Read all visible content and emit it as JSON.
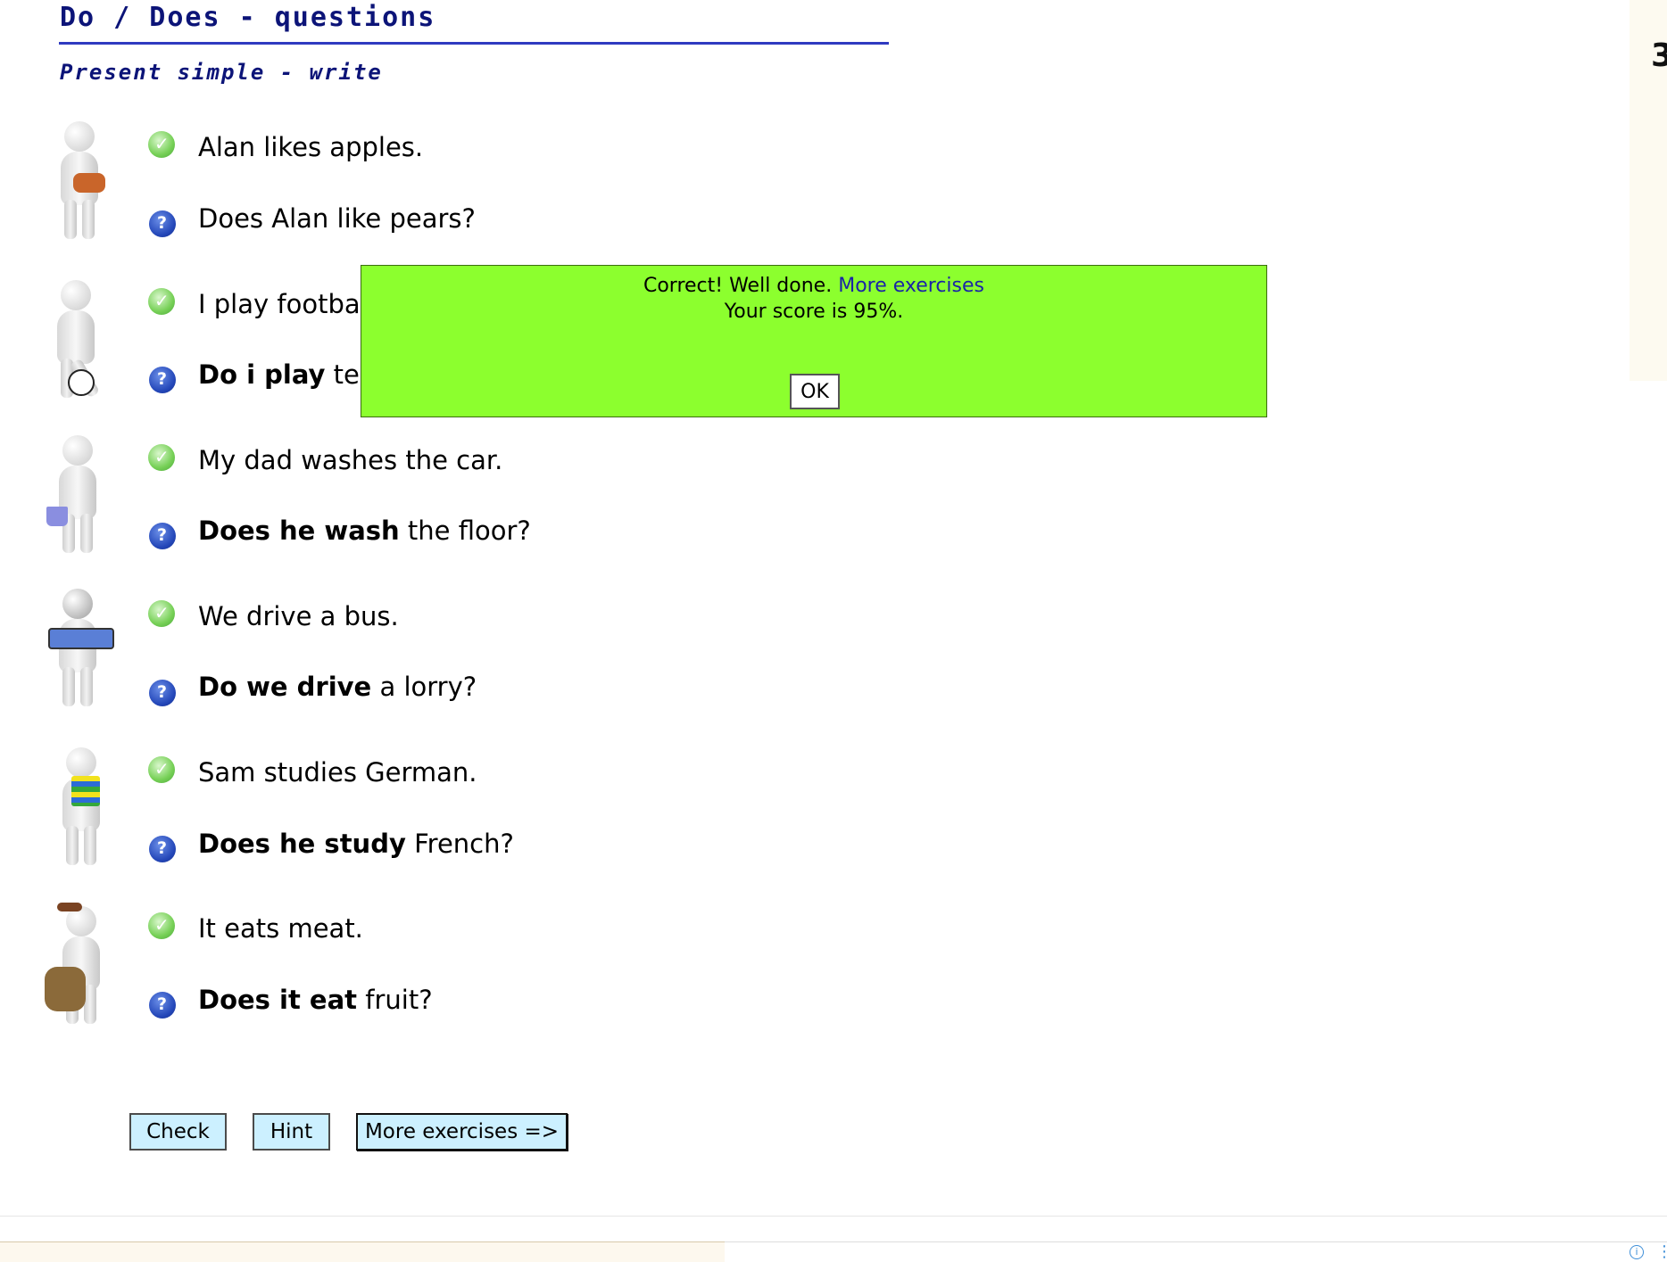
{
  "header": {
    "title": "Do / Does - questions",
    "subtitle": "Present simple - write"
  },
  "right_edge_glyph": "3",
  "items": [
    {
      "figure": "figure-fruit-basket-icon",
      "statement": "Alan likes apples.",
      "q_bold": "",
      "q_rest": "Does Alan like pears?"
    },
    {
      "figure": "figure-football-icon",
      "statement": "I play footba",
      "q_bold": "Do i play",
      "q_rest": " te"
    },
    {
      "figure": "figure-washing-icon",
      "statement": "My dad washes the car.",
      "q_bold": "Does he wash",
      "q_rest": " the floor?"
    },
    {
      "figure": "figure-bus-driver-icon",
      "statement": "We drive a bus.",
      "q_bold": "Do we drive",
      "q_rest": " a lorry?"
    },
    {
      "figure": "figure-books-icon",
      "statement": "Sam studies German.",
      "q_bold": "Does he study",
      "q_rest": " French?"
    },
    {
      "figure": "figure-dog-icon",
      "statement": "It eats meat.",
      "q_bold": "Does it eat",
      "q_rest": " fruit?"
    }
  ],
  "popup": {
    "message": "Correct! Well done.",
    "link": "More exercises",
    "score": "Your score is 95%.",
    "ok": "OK",
    "background": "#8cff2e"
  },
  "buttons": {
    "check": "Check",
    "hint": "Hint",
    "more": "More exercises =>"
  },
  "colors": {
    "heading": "#0c1478",
    "button_bg": "#ccf0ff"
  }
}
